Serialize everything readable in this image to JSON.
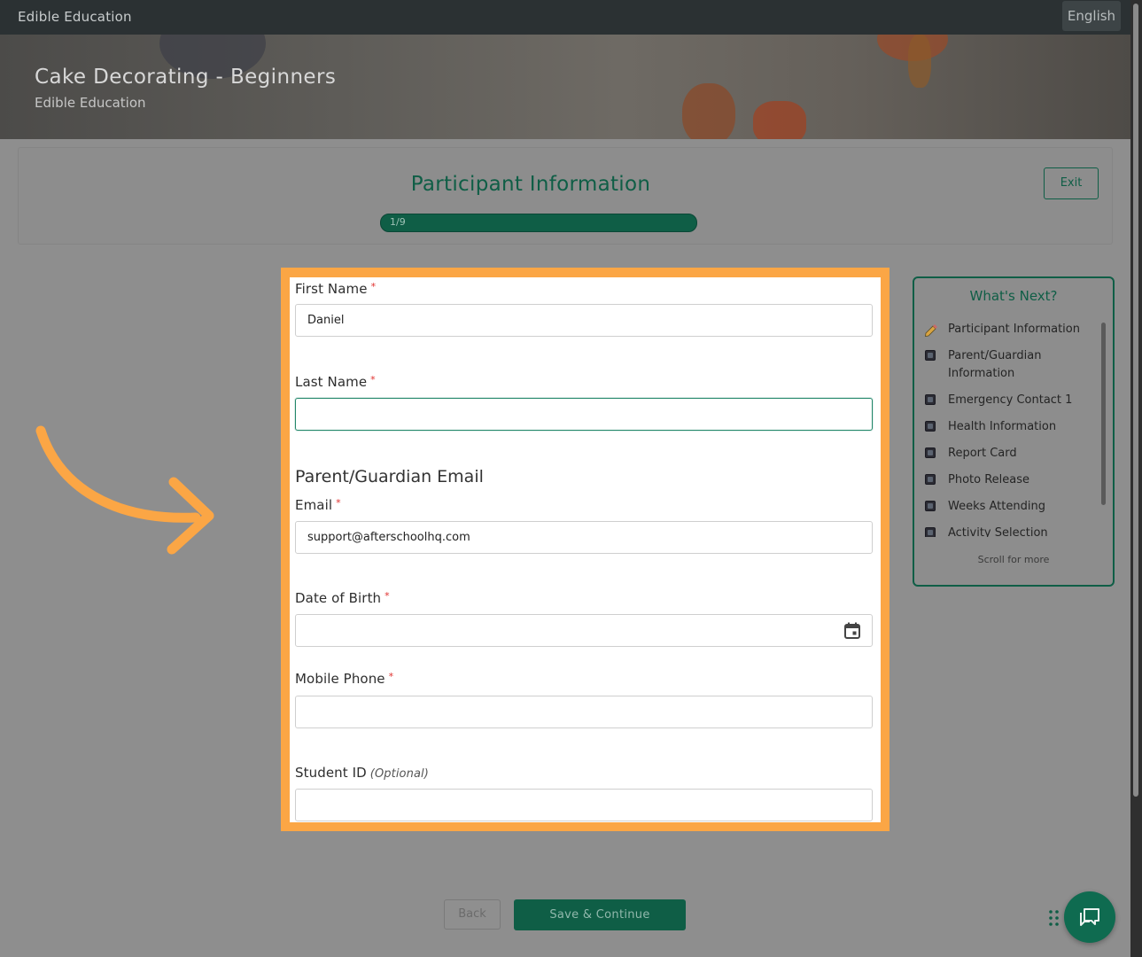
{
  "topbar": {
    "brand": "Edible Education",
    "language": "English"
  },
  "hero": {
    "title": "Cake Decorating - Beginners",
    "subtitle": "Edible Education"
  },
  "step": {
    "title": "Participant Information",
    "progress_label": "1/9",
    "exit_label": "Exit"
  },
  "form": {
    "first_name": {
      "label": "First Name",
      "required": "*",
      "value": "Daniel"
    },
    "last_name": {
      "label": "Last Name",
      "required": "*",
      "value": ""
    },
    "section_heading": "Parent/Guardian Email",
    "email": {
      "label": "Email",
      "required": "*",
      "value": "support@afterschoolhq.com"
    },
    "dob": {
      "label": "Date of Birth",
      "required": "*",
      "value": ""
    },
    "mobile": {
      "label": "Mobile Phone",
      "required": "*",
      "value": ""
    },
    "student_id": {
      "label": "Student ID",
      "optional": "(Optional)",
      "value": ""
    }
  },
  "whats_next": {
    "heading": "What's Next?",
    "items": [
      "Participant Information",
      "Parent/Guardian Information",
      "Emergency Contact 1",
      "Health Information",
      "Report Card",
      "Photo Release",
      "Weeks Attending",
      "Activity Selection"
    ],
    "scroll_hint": "Scroll for more"
  },
  "footer": {
    "back_label": "Back",
    "save_label": "Save & Continue"
  },
  "colors": {
    "accent": "#0f5e46",
    "highlight": "#fba645",
    "required": "#e0302e"
  }
}
